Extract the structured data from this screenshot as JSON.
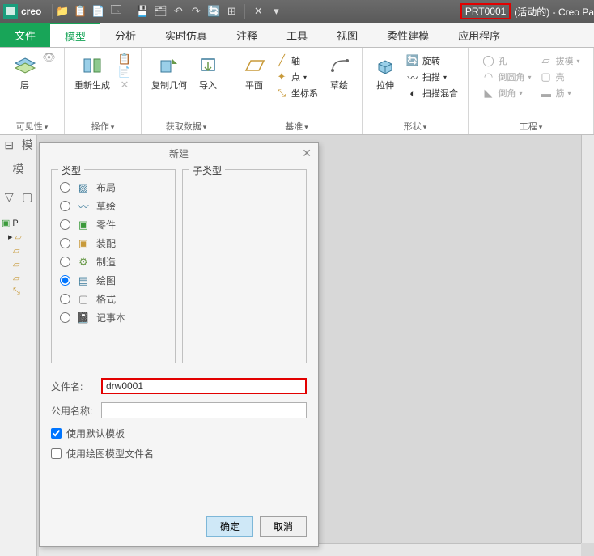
{
  "titlebar": {
    "app": "creo",
    "part": "PRT0001",
    "status": "(活动的)",
    "suffix": "- Creo Pa"
  },
  "tabs": {
    "file": "文件",
    "model": "模型",
    "analysis": "分析",
    "realtime": "实时仿真",
    "annotate": "注释",
    "tools": "工具",
    "view": "视图",
    "flex": "柔性建模",
    "apps": "应用程序"
  },
  "ribbon": {
    "layer": "层",
    "visibility": "可见性",
    "regen": "重新生成",
    "operate": "操作",
    "copygeo": "复制几何",
    "import": "导入",
    "getdata": "获取数据",
    "plane": "平面",
    "axis": "轴",
    "point": "点",
    "csys": "坐标系",
    "datum": "基准",
    "sketch": "草绘",
    "extrude": "拉伸",
    "revolve": "旋转",
    "sweep": "扫描",
    "sweepblend": "扫描混合",
    "shape": "形状",
    "hole": "孔",
    "round": "倒圆角",
    "chamfer": "倒角",
    "draft": "拔模",
    "shell": "壳",
    "rib": "筋",
    "eng": "工程"
  },
  "tree": {
    "header": "模",
    "part": "P"
  },
  "dialog": {
    "title": "新建",
    "type_legend": "类型",
    "subtype_legend": "子类型",
    "types": {
      "layout": "布局",
      "sketch": "草绘",
      "part": "零件",
      "assembly": "装配",
      "mfg": "制造",
      "drawing": "绘图",
      "format": "格式",
      "notebook": "记事本"
    },
    "filename_label": "文件名:",
    "filename_value": "drw0001",
    "common_label": "公用名称:",
    "use_default_template": "使用默认模板",
    "use_drawing_model_filename": "使用绘图模型文件名",
    "ok": "确定",
    "cancel": "取消"
  }
}
